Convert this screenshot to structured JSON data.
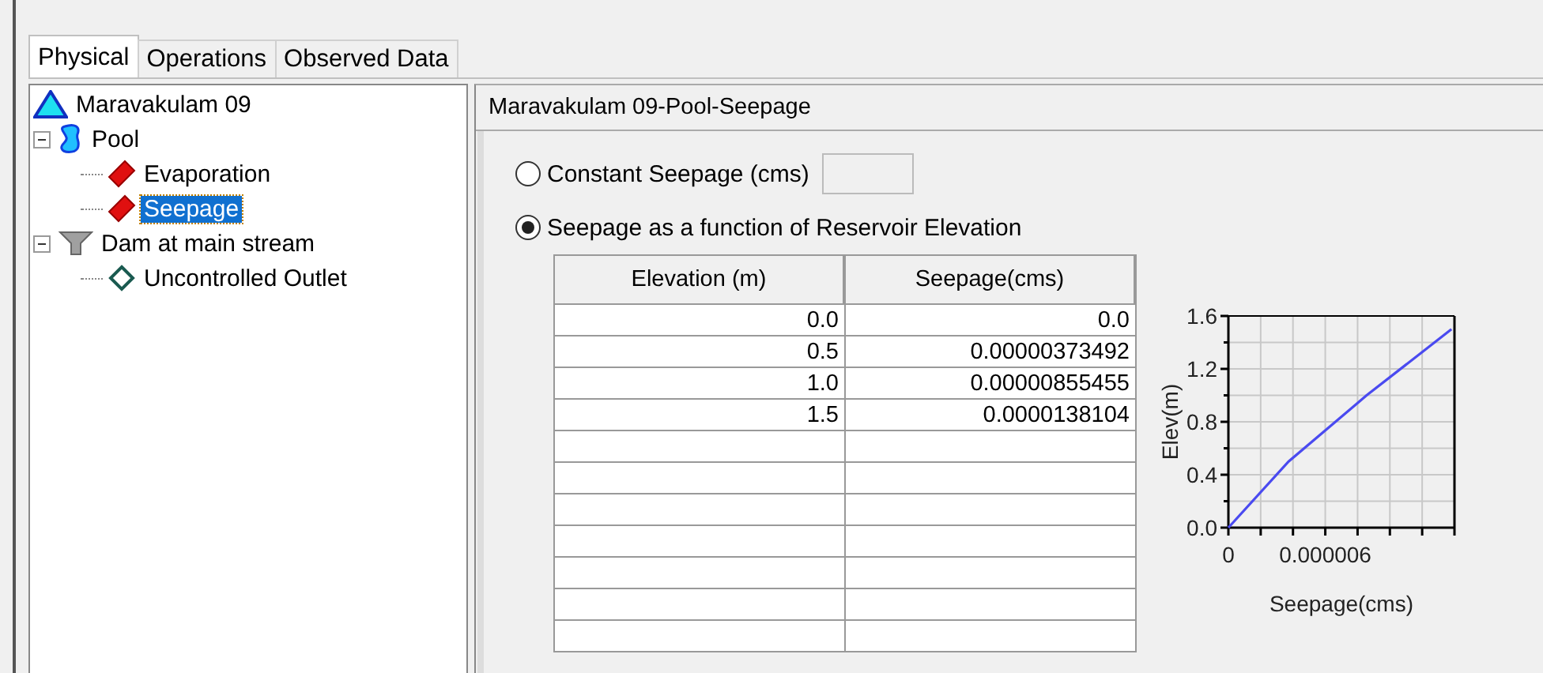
{
  "tabs": [
    {
      "label": "Physical",
      "selected": true
    },
    {
      "label": "Operations",
      "selected": false
    },
    {
      "label": "Observed Data",
      "selected": false
    }
  ],
  "tree": [
    {
      "label": "Maravakulam 09",
      "kind": "reservoir",
      "selected": false,
      "children": [
        {
          "label": "Pool",
          "kind": "pool",
          "selected": false,
          "expanded": true,
          "children": [
            {
              "label": "Evaporation",
              "kind": "method",
              "selected": false
            },
            {
              "label": "Seepage",
              "kind": "method",
              "selected": true
            }
          ]
        },
        {
          "label": "Dam at main stream",
          "kind": "dam",
          "selected": false,
          "expanded": true,
          "children": [
            {
              "label": "Uncontrolled Outlet",
              "kind": "outlet",
              "selected": false
            }
          ]
        }
      ]
    }
  ],
  "panel": {
    "title": "Maravakulam 09-Pool-Seepage",
    "options": [
      {
        "label": "Constant Seepage (cms)",
        "selected": false,
        "kind": "field"
      },
      {
        "label": "Seepage as a function of Reservoir Elevation",
        "selected": true,
        "kind": "plain"
      }
    ],
    "table": {
      "columns": [
        "Elevation (m)",
        "Seepage(cms)"
      ],
      "rows": [
        [
          "0.0",
          "0.0"
        ],
        [
          "0.5",
          "0.00000373492"
        ],
        [
          "1.0",
          "0.00000855455"
        ],
        [
          "1.5",
          "0.0000138104"
        ]
      ]
    },
    "chart_data": {
      "type": "line",
      "xlabel": "Seepage(cms)",
      "ylabel": "Elev(m)",
      "series": [
        {
          "color": "#4a4af0",
          "values": [
            0,
            0.5,
            1.0,
            1.5
          ]
        }
      ],
      "grid": true,
      "x": [
        0,
        3.73492e-06,
        8.55455e-06,
        1.38104e-05
      ],
      "xlim": [
        0,
        1.4e-05
      ],
      "ylim": [
        0,
        1.6
      ],
      "xticks": [
        0,
        {
          "value": 6e-06,
          "label": "0.000006"
        }
      ],
      "yticks": [
        {
          "value": 0,
          "label": "0.0"
        },
        {
          "value": 0.4,
          "label": "0.4"
        },
        {
          "value": 0.8,
          "label": "0.8"
        },
        {
          "value": 1.2,
          "label": "1.2"
        },
        {
          "value": 1.6,
          "label": "1.6"
        }
      ]
    }
  }
}
